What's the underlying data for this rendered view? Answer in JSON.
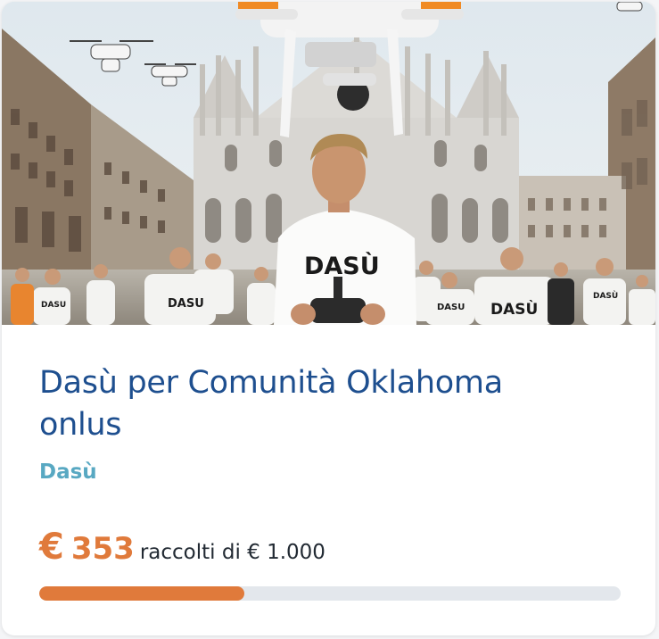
{
  "campaign": {
    "title": "Dasù per Comunità Oklahoma onlus",
    "organization": "Dasù",
    "raised_currency": "€",
    "raised_amount": "353",
    "raised_suffix": "raccolti di € 1.000",
    "progress_fraction": 0.353
  },
  "hero": {
    "shirt_text": "DASÙ",
    "crowd_shirt_texts": [
      "DASU",
      "DASU",
      "DASU",
      "DASÙ",
      "DASÙ"
    ]
  },
  "colors": {
    "title": "#1e4f8f",
    "organization": "#58a8c2",
    "accent": "#e07a3b",
    "track": "#e3e7ec"
  }
}
